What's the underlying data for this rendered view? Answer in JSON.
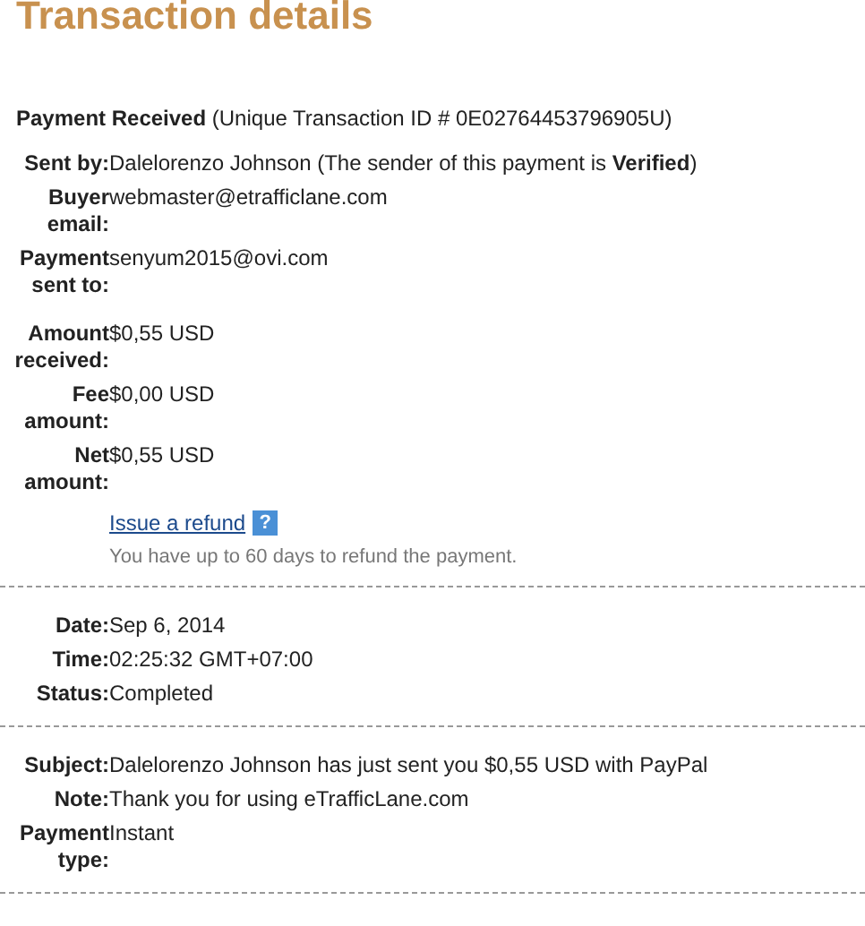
{
  "title": "Transaction details",
  "header": "**Payment Received** (Unique Transaction ID # 0E02764453796905U)",
  "parties": [
    {
      "label": "Sent by:",
      "value": "Dalelorenzo Johnson (The sender of this payment is **Verified**)"
    },
    {
      "label": "Buyer email:",
      "value": "webmaster@etrafficlane.com"
    },
    {
      "label": "Payment sent to:",
      "value": "senyum2015@ovi.com"
    }
  ],
  "amounts": [
    {
      "label": "Amount received:",
      "value": "$0,55 USD"
    },
    {
      "label": "Fee amount:",
      "value": "$0,00 USD"
    },
    {
      "label": "Net amount:",
      "value": "$0,55 USD"
    }
  ],
  "refund": {
    "link": "Issue a refund",
    "help": "?",
    "note": "You have up to 60 days to refund the payment."
  },
  "timing": [
    {
      "label": "Date:",
      "value": "Sep 6, 2014"
    },
    {
      "label": "Time:",
      "value": "02:25:32 GMT+07:00"
    },
    {
      "label": "Status:",
      "value": "Completed"
    }
  ],
  "message": [
    {
      "label": "Subject:",
      "value": "Dalelorenzo Johnson has just sent you $0,55 USD with PayPal"
    },
    {
      "label": "Note:",
      "value": "Thank you for using eTrafficLane.com"
    },
    {
      "label": "Payment type:",
      "value": "Instant"
    }
  ]
}
